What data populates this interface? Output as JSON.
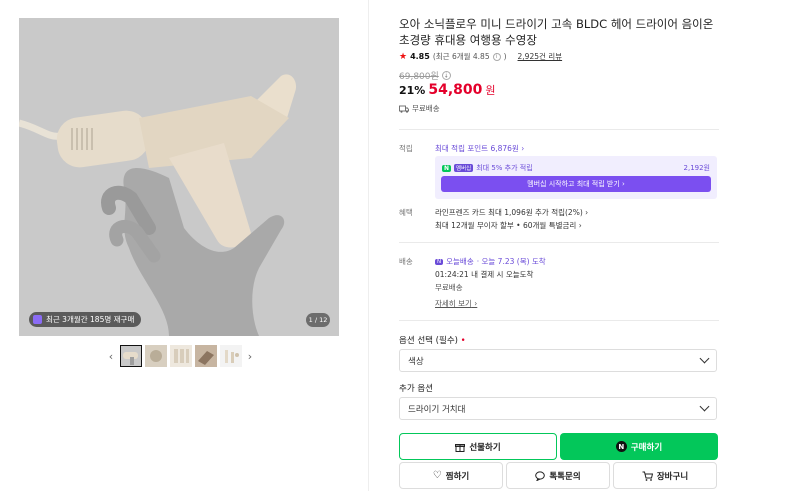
{
  "gallery": {
    "review_badge": "최근 3개월간 185명 재구매",
    "counter": "1 / 12",
    "prev_icon": "chevron-left",
    "next_icon": "chevron-right"
  },
  "product": {
    "title": "오아 소닉플로우 미니 드라이기 고속 BLDC 헤어 드라이어 음이온 초경량 휴대용 여행용 수영장",
    "rating": {
      "score": "4.85",
      "recent": "(최근 6개월 4.85",
      "recent_close": ")",
      "review_count": "2,925건 리뷰"
    },
    "original_price": "69,800원",
    "discount_rate": "21%",
    "sale_price": "54,800",
    "currency": "원",
    "shipping_note": "무료배송"
  },
  "benefits": {
    "points_label": "적립",
    "points_max": "최대 적립 포인트 6,876원",
    "membership_text": "최대 5% 추가 적립",
    "membership_amount": "2,192원",
    "membership_button": "멤버십 시작하고 최대 적립 받기",
    "benefit_label": "혜택",
    "card_benefit": "라인프렌즈 카드 최대 1,096원 추가 적립(2%)",
    "installment": "최대 12개월 무이자 할부 • 60개월 특별금리"
  },
  "delivery": {
    "label": "배송",
    "today_badge": "오늘배송",
    "arrival": "· 오늘 7.23 (목) 도착",
    "countdown": "01:24:21  내 결제 시 오늘도착",
    "free": "무료배송",
    "more_link": "자세히 보기"
  },
  "options": {
    "required_label": "옵션 선택 (필수)",
    "required_mark": "•",
    "color_select": "색상",
    "extra_label": "추가 옵션",
    "extra_select": "드라이기 거치대"
  },
  "actions": {
    "gift": "선물하기",
    "buy": "구매하기",
    "wish": "찜하기",
    "talk": "톡톡문의",
    "cart": "장바구니"
  },
  "colors": {
    "price_red": "#e4002b",
    "naver_green": "#03c75a",
    "membership_purple": "#7b4ff0"
  }
}
